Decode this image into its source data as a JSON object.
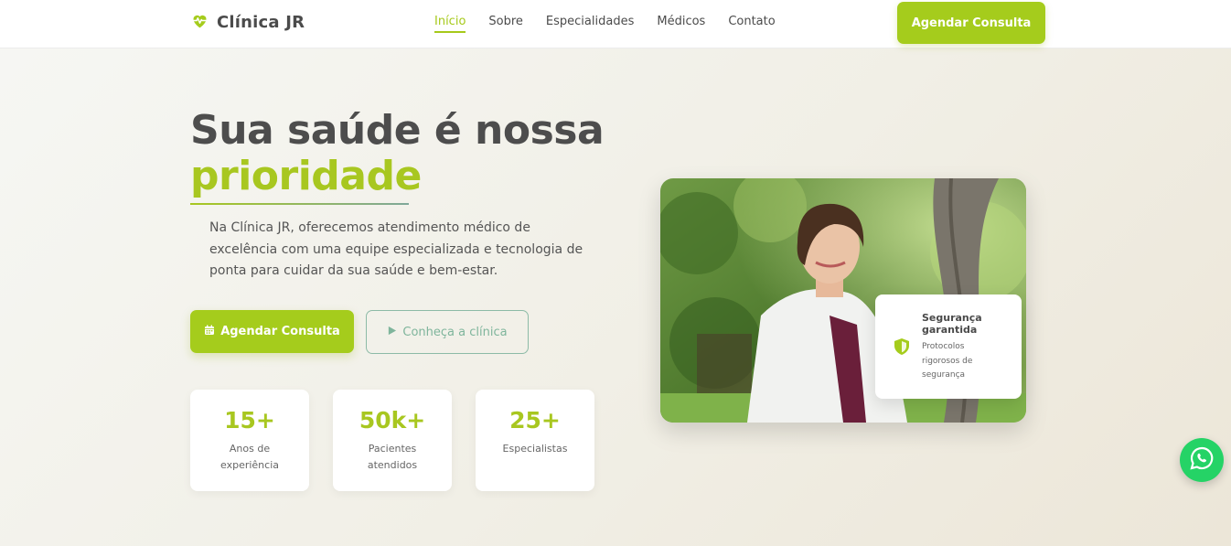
{
  "brand": {
    "name": "Clínica JR",
    "logo_icon": "heart-pulse-icon",
    "accent_color": "#a5cc1c"
  },
  "nav": {
    "items": [
      {
        "label": "Início",
        "active": true
      },
      {
        "label": "Sobre",
        "active": false
      },
      {
        "label": "Especialidades",
        "active": false
      },
      {
        "label": "Médicos",
        "active": false
      },
      {
        "label": "Contato",
        "active": false
      }
    ],
    "cta_label": "Agendar Consulta"
  },
  "hero": {
    "title": "Sua saúde é nossa",
    "title_accent": "prioridade",
    "description": "Na Clínica JR, oferecemos atendimento médico de excelência com uma equipe especializada e tecnologia de ponta para cuidar da sua saúde e bem-estar.",
    "primary_button": {
      "label": "Agendar Consulta",
      "icon": "calendar-icon"
    },
    "secondary_button": {
      "label": "Conheça a clínica",
      "icon": "play-icon"
    }
  },
  "stats": [
    {
      "value": "15+",
      "label": "Anos de experiência"
    },
    {
      "value": "50k+",
      "label": "Pacientes atendidos"
    },
    {
      "value": "25+",
      "label": "Especialistas"
    }
  ],
  "security_card": {
    "icon": "shield-icon",
    "title": "Segurança garantida",
    "text": "Protocolos rigorosos de segurança"
  },
  "whatsapp": {
    "icon": "whatsapp-icon",
    "color": "#25d366"
  }
}
